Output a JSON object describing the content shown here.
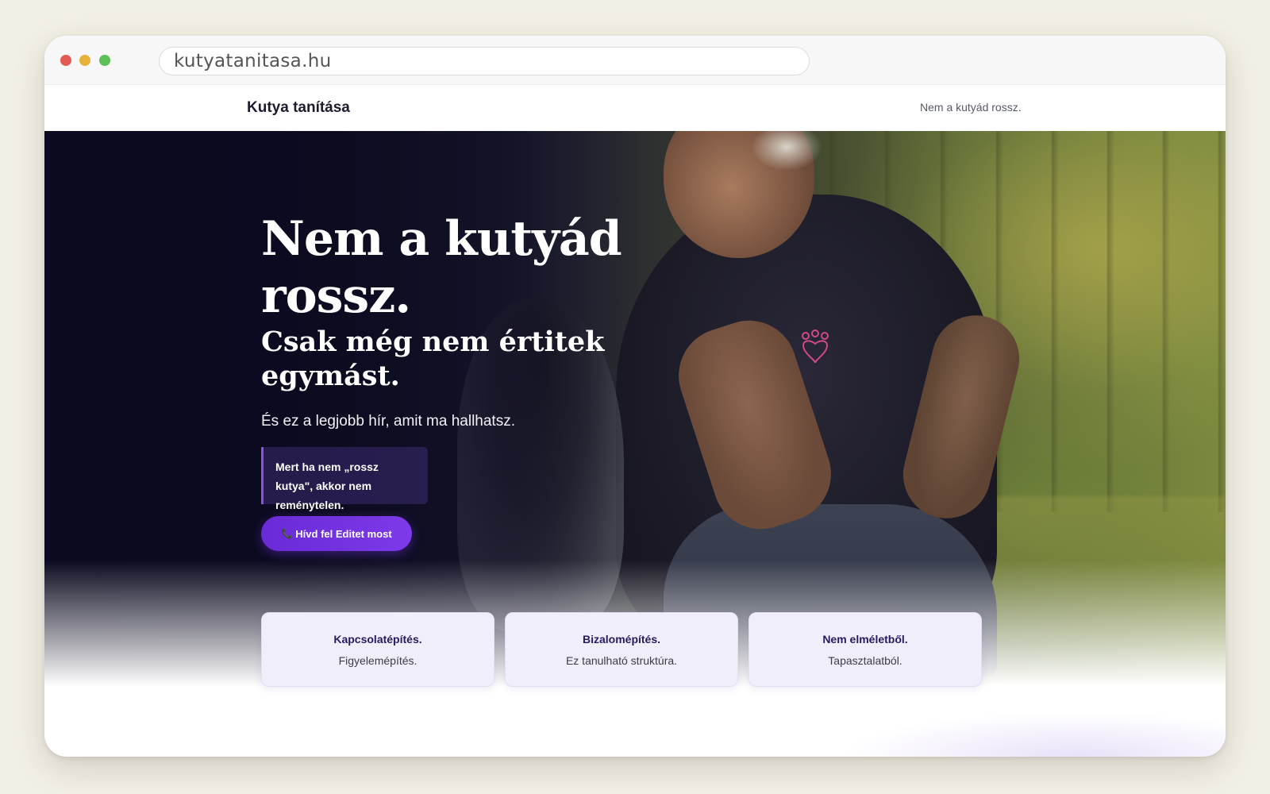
{
  "browser": {
    "url": "kutyatanitasa.hu"
  },
  "nav": {
    "brand": "Kutya tanítása",
    "tagline_link": "Nem a kutyád rossz."
  },
  "hero": {
    "headline": "Nem a kutyád rossz.",
    "subheadline": "Csak még nem értitek egymást.",
    "lede": "És ez a legjobb hír, amit ma hallhatsz.",
    "quote": "Mert ha nem „rossz kutya\", akkor nem reménytelen.",
    "cta_icon": "phone-icon",
    "cta_label": "Hívd fel Editet most"
  },
  "features": [
    {
      "title": "Kapcsolatépítés.",
      "text": "Figyelemépítés."
    },
    {
      "title": "Bizalomépítés.",
      "text": "Ez tanulható struktúra."
    },
    {
      "title": "Nem elméletből.",
      "text": "Tapasztalatból."
    }
  ],
  "colors": {
    "accent": "#7d3ae8",
    "card_bg": "#f1eefb",
    "hero_dark": "#0b0a1f",
    "card_title": "#2a1960"
  }
}
